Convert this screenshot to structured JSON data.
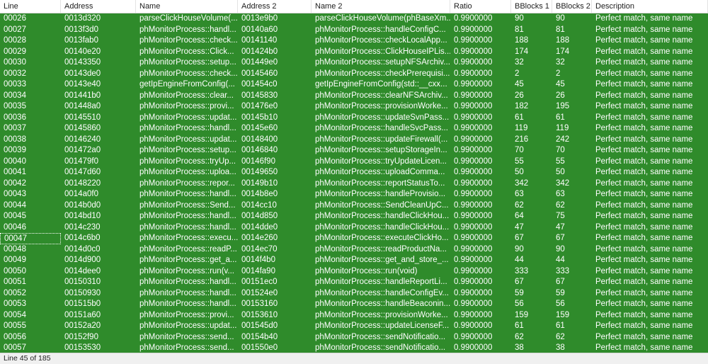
{
  "headers": [
    "Line",
    "Address",
    "Name",
    "Address 2",
    "Name 2",
    "Ratio",
    "BBlocks 1",
    "BBlocks 2",
    "Description"
  ],
  "rows": [
    [
      "00026",
      "0013d320",
      "parseClickHouseVolume(...",
      "0013e9b0",
      "parseClickHouseVolume(phBaseXm...",
      "0.9900000",
      "90",
      "90",
      "Perfect match, same name"
    ],
    [
      "00027",
      "0013f3d0",
      "phMonitorProcess::handl...",
      "00140a60",
      "phMonitorProcess::handleConfigC...",
      "0.9900000",
      "81",
      "81",
      "Perfect match, same name"
    ],
    [
      "00028",
      "0013fab0",
      "phMonitorProcess::check...",
      "00141140",
      "phMonitorProcess::checkLocalApp...",
      "0.9900000",
      "188",
      "188",
      "Perfect match, same name"
    ],
    [
      "00029",
      "00140e20",
      "phMonitorProcess::Click...",
      "001424b0",
      "phMonitorProcess::ClickHouseIPLis...",
      "0.9900000",
      "174",
      "174",
      "Perfect match, same name"
    ],
    [
      "00030",
      "00143350",
      "phMonitorProcess::setup...",
      "001449e0",
      "phMonitorProcess::setupNFSArchiv...",
      "0.9900000",
      "32",
      "32",
      "Perfect match, same name"
    ],
    [
      "00032",
      "00143de0",
      "phMonitorProcess::check...",
      "00145460",
      "phMonitorProcess::checkPrerequisi...",
      "0.9900000",
      "2",
      "2",
      "Perfect match, same name"
    ],
    [
      "00033",
      "00143e40",
      "getIpEngineFromConfig(...",
      "001454c0",
      "getIpEngineFromConfig(std::__cxx...",
      "0.9900000",
      "45",
      "45",
      "Perfect match, same name"
    ],
    [
      "00034",
      "001441b0",
      "phMonitorProcess::clear...",
      "00145830",
      "phMonitorProcess::clearNFSArchiv...",
      "0.9900000",
      "26",
      "26",
      "Perfect match, same name"
    ],
    [
      "00035",
      "001448a0",
      "phMonitorProcess::provi...",
      "001476e0",
      "phMonitorProcess::provisionWorke...",
      "0.9900000",
      "182",
      "195",
      "Perfect match, same name"
    ],
    [
      "00036",
      "00145510",
      "phMonitorProcess::updat...",
      "00145b10",
      "phMonitorProcess::updateSvnPass...",
      "0.9900000",
      "61",
      "61",
      "Perfect match, same name"
    ],
    [
      "00037",
      "00145860",
      "phMonitorProcess::handl...",
      "00145e60",
      "phMonitorProcess::handleSvcPass...",
      "0.9900000",
      "119",
      "119",
      "Perfect match, same name"
    ],
    [
      "00038",
      "00146240",
      "phMonitorProcess::updat...",
      "00148400",
      "phMonitorProcess::updateFirewall(...",
      "0.9900000",
      "216",
      "242",
      "Perfect match, same name"
    ],
    [
      "00039",
      "001472a0",
      "phMonitorProcess::setup...",
      "00146840",
      "phMonitorProcess::setupStorageIn...",
      "0.9900000",
      "70",
      "70",
      "Perfect match, same name"
    ],
    [
      "00040",
      "001479f0",
      "phMonitorProcess::tryUp...",
      "00146f90",
      "phMonitorProcess::tryUpdateLicen...",
      "0.9900000",
      "55",
      "55",
      "Perfect match, same name"
    ],
    [
      "00041",
      "00147d60",
      "phMonitorProcess::uploa...",
      "00149650",
      "phMonitorProcess::uploadComma...",
      "0.9900000",
      "50",
      "50",
      "Perfect match, same name"
    ],
    [
      "00042",
      "00148220",
      "phMonitorProcess::repor...",
      "00149b10",
      "phMonitorProcess::reportStatusTo...",
      "0.9900000",
      "342",
      "342",
      "Perfect match, same name"
    ],
    [
      "00043",
      "0014a0f0",
      "phMonitorProcess::handl...",
      "0014b8e0",
      "phMonitorProcess::handleProvisio...",
      "0.9900000",
      "63",
      "63",
      "Perfect match, same name"
    ],
    [
      "00044",
      "0014b0d0",
      "phMonitorProcess::Send...",
      "0014cc10",
      "phMonitorProcess::SendCleanUpC...",
      "0.9900000",
      "62",
      "62",
      "Perfect match, same name"
    ],
    [
      "00045",
      "0014bd10",
      "phMonitorProcess::handl...",
      "0014d850",
      "phMonitorProcess::handleClickHou...",
      "0.9900000",
      "64",
      "75",
      "Perfect match, same name"
    ],
    [
      "00046",
      "0014c230",
      "phMonitorProcess::handl...",
      "0014dde0",
      "phMonitorProcess::handleClickHou...",
      "0.9900000",
      "47",
      "47",
      "Perfect match, same name"
    ],
    [
      "00047",
      "0014c6b0",
      "phMonitorProcess::execu...",
      "0014e260",
      "phMonitorProcess::executeClickHo...",
      "0.9900000",
      "67",
      "67",
      "Perfect match, same name"
    ],
    [
      "00048",
      "0014d0c0",
      "phMonitorProcess::readP...",
      "0014ec70",
      "phMonitorProcess::readProductNa...",
      "0.9900000",
      "90",
      "90",
      "Perfect match, same name"
    ],
    [
      "00049",
      "0014d900",
      "phMonitorProcess::get_a...",
      "0014f4b0",
      "phMonitorProcess::get_and_store_...",
      "0.9900000",
      "44",
      "44",
      "Perfect match, same name"
    ],
    [
      "00050",
      "0014dee0",
      "phMonitorProcess::run(v...",
      "0014fa90",
      "phMonitorProcess::run(void)",
      "0.9900000",
      "333",
      "333",
      "Perfect match, same name"
    ],
    [
      "00051",
      "00150310",
      "phMonitorProcess::handl...",
      "00151ec0",
      "phMonitorProcess::handleReportLi...",
      "0.9900000",
      "67",
      "67",
      "Perfect match, same name"
    ],
    [
      "00052",
      "00150930",
      "phMonitorProcess::handl...",
      "001524e0",
      "phMonitorProcess::handleConfigEv...",
      "0.9900000",
      "59",
      "59",
      "Perfect match, same name"
    ],
    [
      "00053",
      "001515b0",
      "phMonitorProcess::handl...",
      "00153160",
      "phMonitorProcess::handleBeaconin...",
      "0.9900000",
      "56",
      "56",
      "Perfect match, same name"
    ],
    [
      "00054",
      "00151a60",
      "phMonitorProcess::provi...",
      "00153610",
      "phMonitorProcess::provisionWorke...",
      "0.9900000",
      "159",
      "159",
      "Perfect match, same name"
    ],
    [
      "00055",
      "00152a20",
      "phMonitorProcess::updat...",
      "001545d0",
      "phMonitorProcess::updateLicenseF...",
      "0.9900000",
      "61",
      "61",
      "Perfect match, same name"
    ],
    [
      "00056",
      "00152f90",
      "phMonitorProcess::send...",
      "00154b40",
      "phMonitorProcess::sendNotificatio...",
      "0.9900000",
      "62",
      "62",
      "Perfect match, same name"
    ],
    [
      "00057",
      "00153530",
      "phMonitorProcess::send...",
      "001550e0",
      "phMonitorProcess::sendNotificatio...",
      "0.9900000",
      "38",
      "38",
      "Perfect match, same name"
    ]
  ],
  "focused_row": "00047",
  "status": {
    "text": "Line 45 of 185"
  },
  "colors": {
    "match_row_bg": "#2f8b2b",
    "row_text": "#ffffff"
  }
}
